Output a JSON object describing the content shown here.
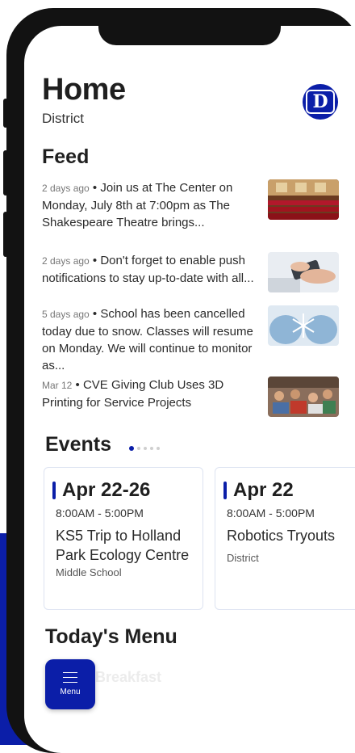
{
  "header": {
    "title": "Home",
    "subtitle": "District",
    "logo_letter": "D"
  },
  "feed": {
    "title": "Feed",
    "items": [
      {
        "date": "2 days ago",
        "text": "Join us at The Center on Monday, July 8th at 7:00pm as The Shakespeare Theatre brings...",
        "image": "theater-seats-image"
      },
      {
        "date": "2 days ago",
        "text": "Don't forget to enable push notifications to stay up-to-date with all...",
        "image": "phone-hands-image"
      },
      {
        "date": "5 days ago",
        "text": "School has been cancelled today due to snow. Classes will resume on Monday. We will continue to monitor as...",
        "image": "snowflake-mittens-image"
      },
      {
        "date": "Mar 12",
        "text": "CVE Giving Club Uses 3D Printing for Service Projects",
        "image": "classroom-image"
      }
    ]
  },
  "events": {
    "title": "Events",
    "carousel_active_index": 0,
    "carousel_count": 5,
    "cards": [
      {
        "date": "Apr 22-26",
        "time": "8:00AM  -  5:00PM",
        "name": "KS5 Trip to Holland Park Ecology Centre",
        "location": "Middle School"
      },
      {
        "date": "Apr 22",
        "time": "8:00AM  -  5:00PM",
        "name": "Robotics Tryouts",
        "location": "District"
      }
    ]
  },
  "menu_section": {
    "title": "Today's Menu",
    "first_item": "Breakfast"
  },
  "fab": {
    "label": "Menu",
    "icon": "hamburger-icon"
  },
  "colors": {
    "accent": "#0b1ea8",
    "text": "#1f1f1f"
  }
}
